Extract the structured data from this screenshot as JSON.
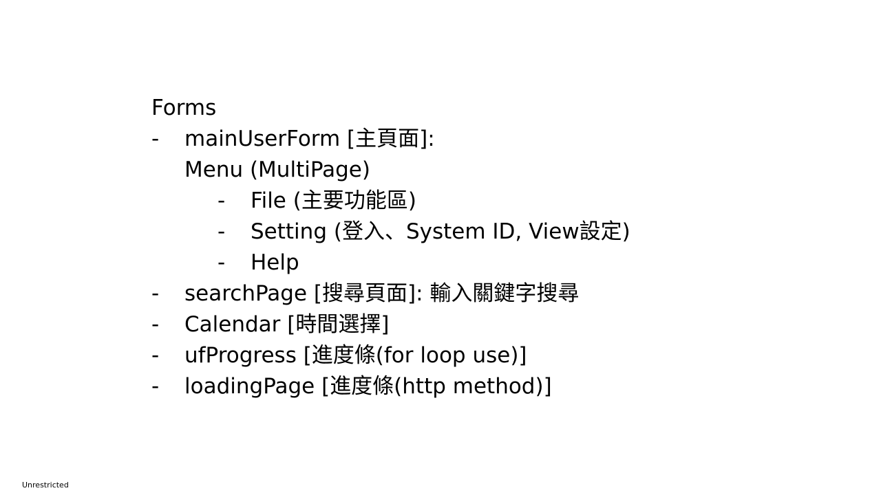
{
  "slide": {
    "title": "Forms",
    "items": [
      {
        "dash": "-",
        "text": "mainUserForm [主頁面]:"
      },
      {
        "text": "Menu (MultiPage)"
      },
      {
        "dash": "-",
        "text": "File (主要功能區)"
      },
      {
        "dash": "-",
        "text": "Setting (登入、System ID, View設定)"
      },
      {
        "dash": "-",
        "text": "Help"
      },
      {
        "dash": "-",
        "text": "searchPage [搜尋頁面]: 輸入關鍵字搜尋"
      },
      {
        "dash": "-",
        "text": "Calendar [時間選擇]"
      },
      {
        "dash": "-",
        "text": "ufProgress [進度條(for loop use)]"
      },
      {
        "dash": "-",
        "text": "loadingPage [進度條(http method)]"
      }
    ]
  },
  "footer": {
    "label": "Unrestricted"
  }
}
